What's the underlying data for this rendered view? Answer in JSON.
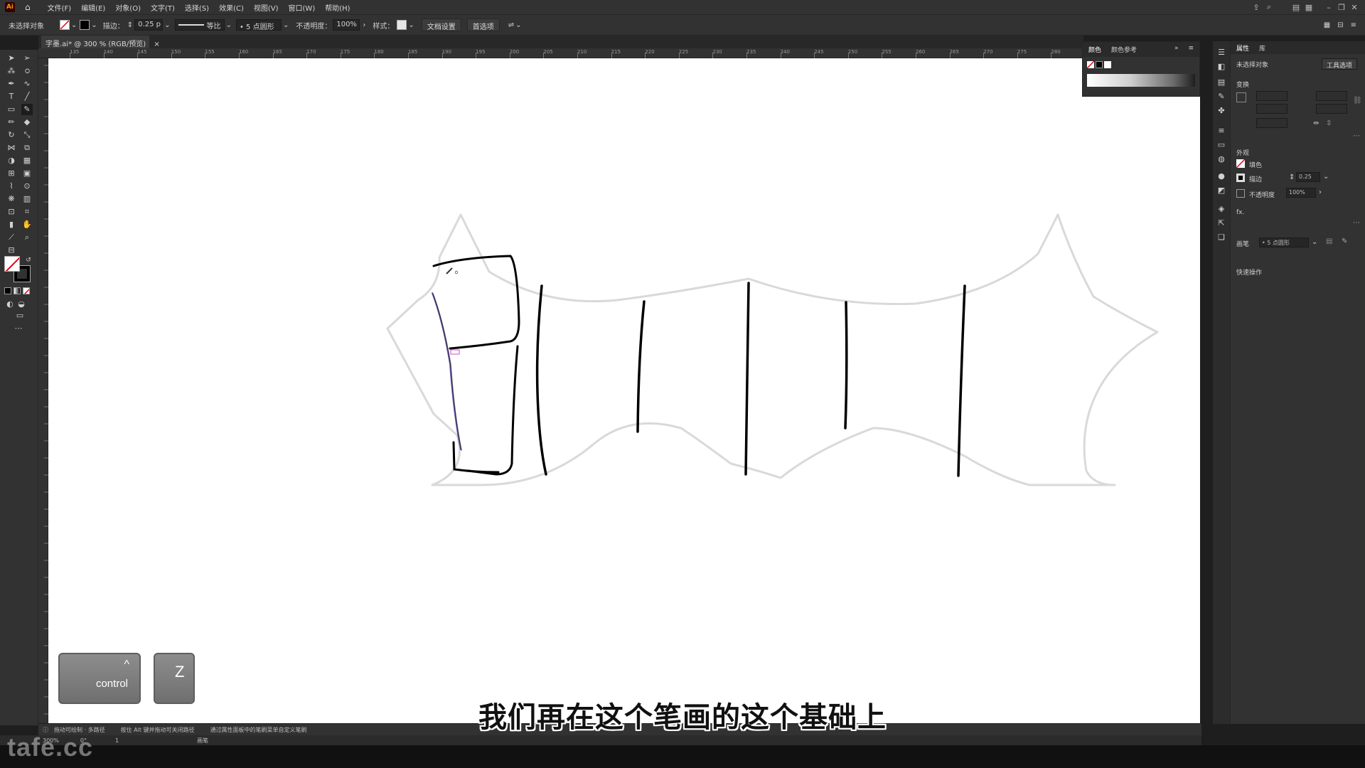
{
  "app": {
    "logo": "Ai",
    "menus": [
      "文件(F)",
      "编辑(E)",
      "对象(O)",
      "文字(T)",
      "选择(S)",
      "效果(C)",
      "视图(V)",
      "窗口(W)",
      "帮助(H)"
    ]
  },
  "control_bar": {
    "selection_status": "未选择对象",
    "stroke_label": "描边：",
    "stroke_value": "0.25 p",
    "stroke_profile": "等比",
    "brush": "5 点圆形",
    "opacity_label": "不透明度：",
    "opacity_value": "100%",
    "style_label": "样式：",
    "doc_setup_button": "文档设置",
    "preferences_button": "首选项"
  },
  "document_tab": {
    "title": "字墨.ai* @ 300 % (RGB/预览)",
    "close": "×"
  },
  "ruler": {
    "h_ticks": [
      "135",
      "140",
      "145",
      "150",
      "155",
      "160",
      "165",
      "170",
      "175",
      "180",
      "185",
      "190",
      "195",
      "200",
      "205",
      "210",
      "215",
      "220",
      "225",
      "230",
      "235",
      "240",
      "245",
      "250",
      "255",
      "260",
      "265",
      "270",
      "275",
      "280"
    ]
  },
  "color_panel": {
    "tab_color": "颜色",
    "tab_color_guide": "颜色参考"
  },
  "properties_panel": {
    "tab_properties": "属性",
    "tab_layers": "库",
    "no_selection": "未选择对象",
    "tool_options_button": "工具选项",
    "transform_heading": "变换",
    "appearance_heading": "外观",
    "fill_label": "填色",
    "stroke_label": "描边",
    "stroke_value": "0.25",
    "opacity_label": "不透明度",
    "opacity_value": "100%",
    "fx_label": "fx.",
    "brush_label": "画笔",
    "brush_value": "5 点圆形",
    "quick_actions_heading": "快速操作"
  },
  "status_bar": {
    "hint1": "拖动可绘制 · 多路径",
    "hint2": "按住 Alt 键并拖动可关闭路径",
    "hint3": "通过属性面板中的笔刷菜单自定义笔刷",
    "zoom": "300%",
    "rotation": "0°",
    "artboard": "1",
    "tool_name": "画笔"
  },
  "keys": {
    "control_caret": "^",
    "control_label": "control",
    "z_label": "Z"
  },
  "subtitle": "我们再在这个笔画的这个基础上",
  "watermark": "tafe.cc",
  "colors": {
    "ui_dark": "#323232",
    "canvas": "#ffffff",
    "stroke_black": "#000000",
    "guide_gray": "#d9d9d9",
    "selected_path": "#6b5fb5"
  }
}
